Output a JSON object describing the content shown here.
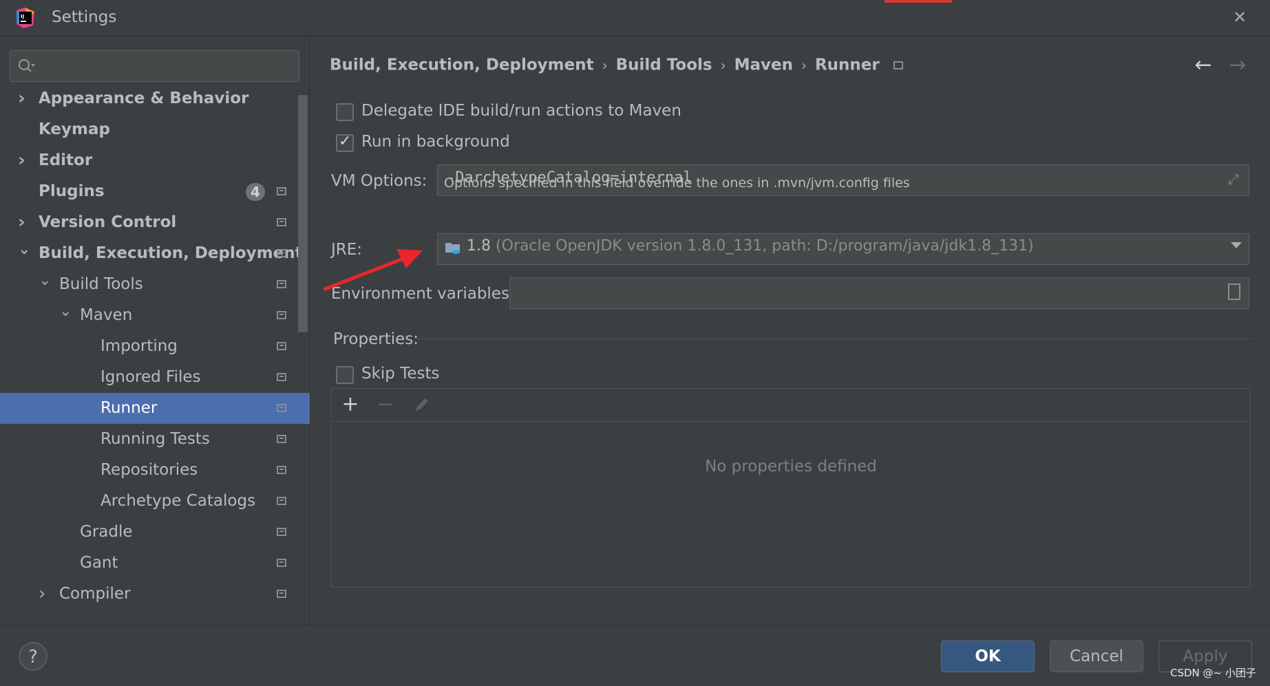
{
  "window": {
    "title": "Settings",
    "close_icon": "close-icon"
  },
  "sidebar": {
    "search": {
      "placeholder": "",
      "value": ""
    },
    "items": [
      {
        "label": "Appearance & Behavior",
        "expandable": true,
        "expanded": false,
        "bold": true
      },
      {
        "label": "Keymap",
        "bold": true
      },
      {
        "label": "Editor",
        "expandable": true,
        "expanded": false,
        "bold": true
      },
      {
        "label": "Plugins",
        "bold": true,
        "badge": "4"
      },
      {
        "label": "Version Control",
        "expandable": true,
        "expanded": false,
        "bold": true
      },
      {
        "label": "Build, Execution, Deployment",
        "expandable": true,
        "expanded": true,
        "bold": true
      },
      {
        "label": "Build Tools",
        "expandable": true,
        "expanded": true
      },
      {
        "label": "Maven",
        "expandable": true,
        "expanded": true
      },
      {
        "label": "Importing"
      },
      {
        "label": "Ignored Files"
      },
      {
        "label": "Runner",
        "selected": true
      },
      {
        "label": "Running Tests"
      },
      {
        "label": "Repositories"
      },
      {
        "label": "Archetype Catalogs"
      },
      {
        "label": "Gradle"
      },
      {
        "label": "Gant"
      },
      {
        "label": "Compiler",
        "expandable": true,
        "expanded": false
      }
    ]
  },
  "breadcrumb": [
    "Build, Execution, Deployment",
    "Build Tools",
    "Maven",
    "Runner"
  ],
  "runner": {
    "delegate_label": "Delegate IDE build/run actions to Maven",
    "delegate_checked": false,
    "background_label": "Run in background",
    "background_checked": true,
    "vm_options_label": "VM Options:",
    "vm_options_value": "-DarchetypeCatalog=internal",
    "vm_hint": "Options specified in this field override the ones in .mvn/jvm.config files",
    "jre_label": "JRE:",
    "jre_version": "1.8",
    "jre_detail": "(Oracle OpenJDK version 1.8.0_131, path: D:/program/java/jdk1.8_131)",
    "env_label": "Environment variables:",
    "env_value": "",
    "properties_label": "Properties:",
    "skip_tests_label": "Skip Tests",
    "skip_tests_checked": false,
    "no_properties_text": "No properties defined"
  },
  "buttons": {
    "ok": "OK",
    "cancel": "Cancel",
    "apply": "Apply",
    "help": "?"
  },
  "watermark": "CSDN @~ 小团子",
  "colors": {
    "selection": "#4b6eaf",
    "ok_button": "#365880",
    "annotation_arrow": "#e8262b",
    "background": "#3c3f41"
  }
}
